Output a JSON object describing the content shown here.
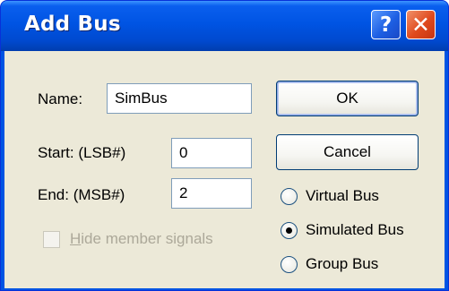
{
  "dialog": {
    "title": "Add Bus",
    "help_glyph": "?",
    "close_glyph": "✕"
  },
  "form": {
    "name_label": "Name:",
    "name_value": "SimBus",
    "start_label": "Start: (LSB#)",
    "start_value": "0",
    "end_label": "End: (MSB#)",
    "end_value": "2",
    "hide_member_first": "H",
    "hide_member_rest": "ide member signals"
  },
  "buttons": {
    "ok_label": "OK",
    "cancel_label": "Cancel"
  },
  "bus_type": {
    "options": [
      "Virtual Bus",
      "Simulated Bus",
      "Group Bus"
    ],
    "selected": "Simulated Bus"
  },
  "colors": {
    "titlebar": "#0054e3",
    "client_bg": "#ece9d8",
    "close_red": "#e04a1d",
    "disabled_text": "#aca899"
  },
  "icons": [
    "help-icon",
    "close-icon"
  ]
}
